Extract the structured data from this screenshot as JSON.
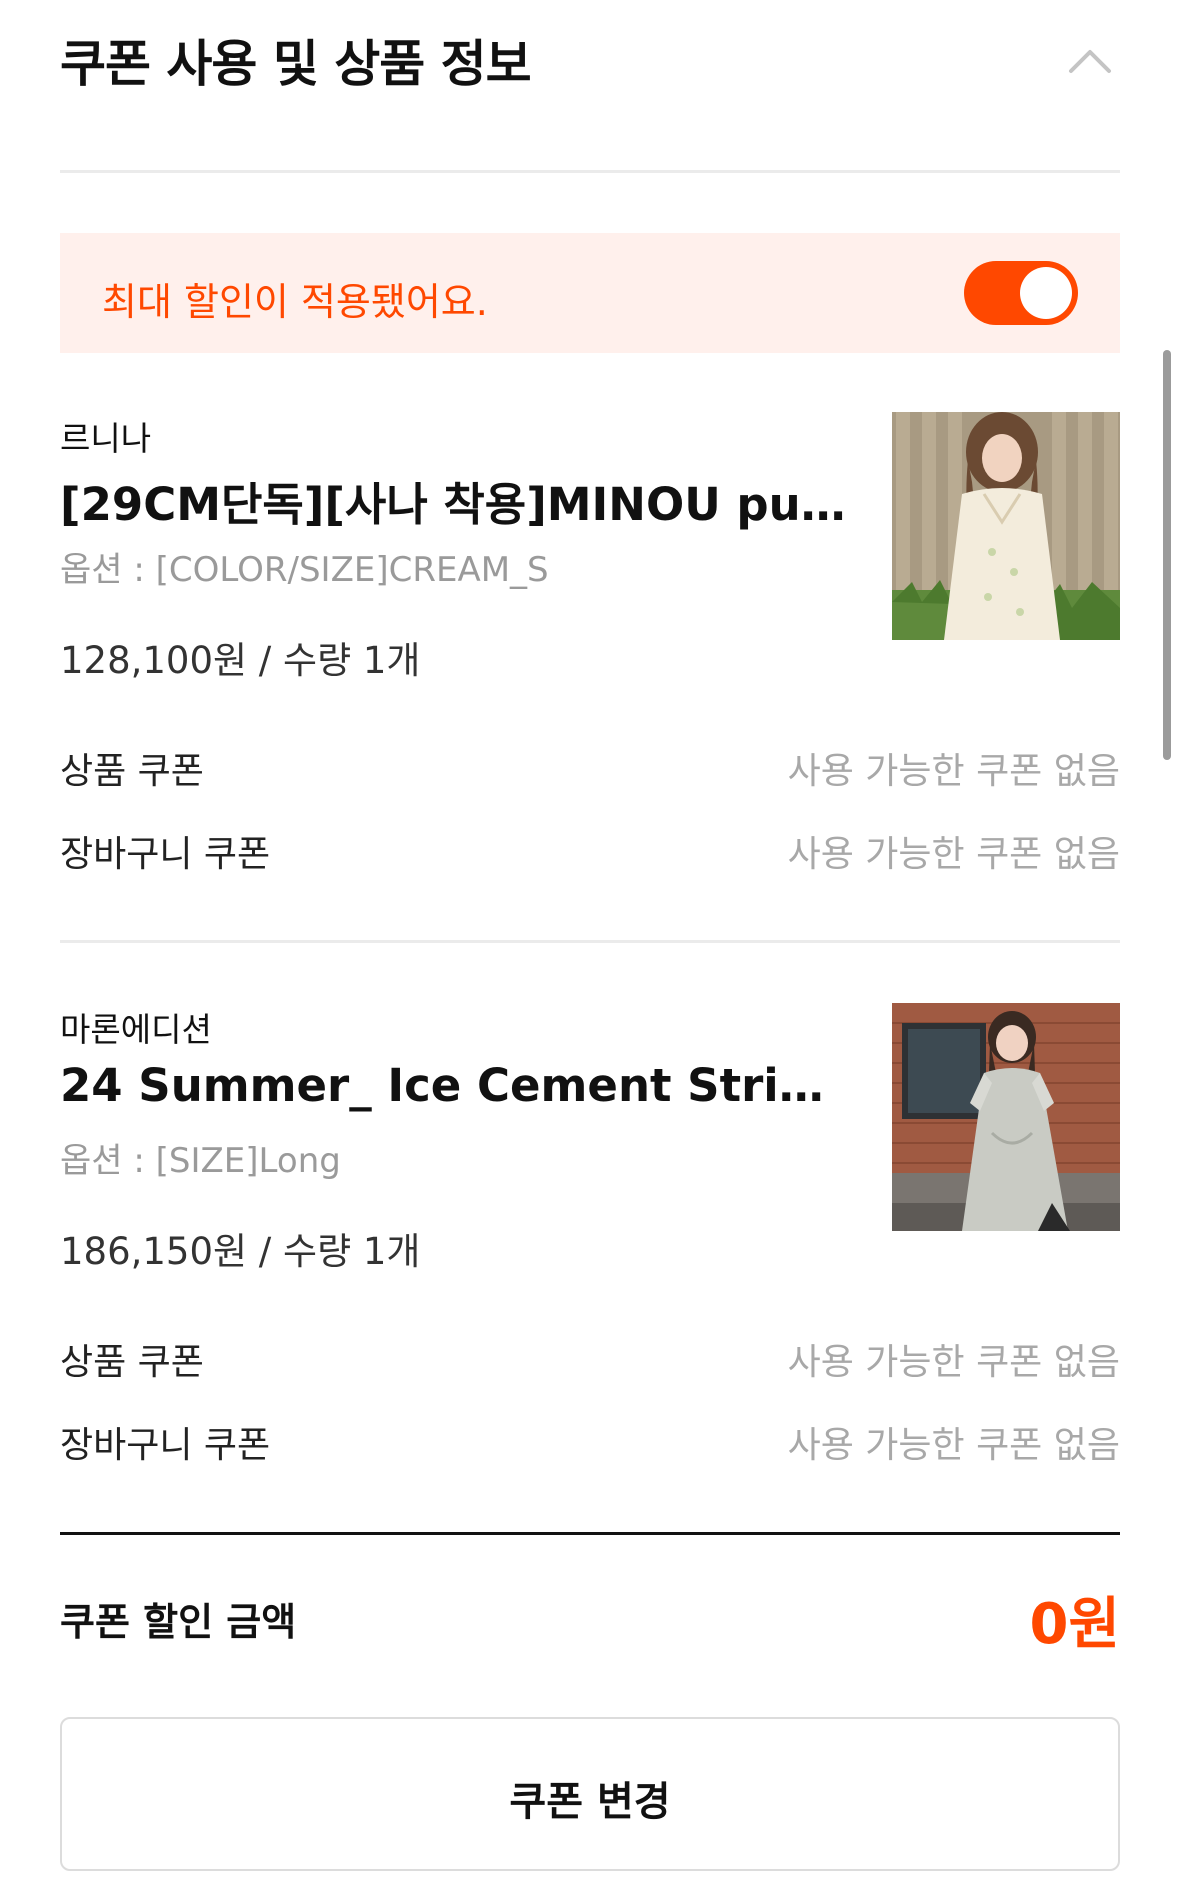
{
  "header": {
    "title": "쿠폰 사용 및 상품 정보"
  },
  "banner": {
    "text": "최대 할인이 적용됐어요.",
    "toggle_on": true
  },
  "products": [
    {
      "brand": "르니나",
      "name": "[29CM단독][사나 착용]MINOU pu...",
      "option": "옵션 : [COLOR/SIZE]CREAM_S",
      "price_qty": "128,100원 / 수량 1개",
      "product_coupon_label": "상품 쿠폰",
      "product_coupon_value": "사용 가능한 쿠폰 없음",
      "cart_coupon_label": "장바구니 쿠폰",
      "cart_coupon_value": "사용 가능한 쿠폰 없음"
    },
    {
      "brand": "마론에디션",
      "name": "24 Summer_ Ice Cement String...",
      "option": "옵션 : [SIZE]Long",
      "price_qty": "186,150원 / 수량 1개",
      "product_coupon_label": "상품 쿠폰",
      "product_coupon_value": "사용 가능한 쿠폰 없음",
      "cart_coupon_label": "장바구니 쿠폰",
      "cart_coupon_value": "사용 가능한 쿠폰 없음"
    }
  ],
  "summary": {
    "label": "쿠폰 할인 금액",
    "amount": "0원"
  },
  "actions": {
    "change_coupon": "쿠폰 변경"
  },
  "colors": {
    "accent": "#ff4800",
    "banner_bg": "#fff0ec"
  }
}
